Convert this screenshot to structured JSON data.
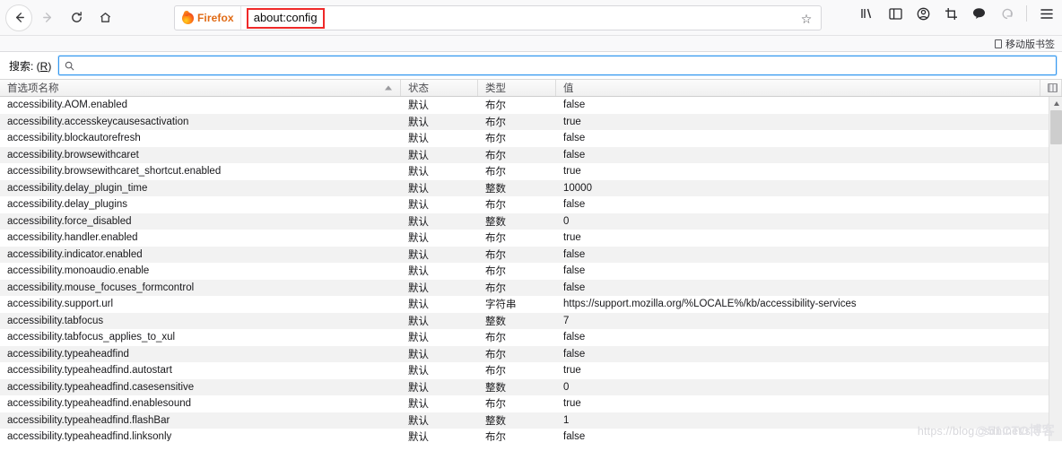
{
  "browser": {
    "nav": {
      "back_label": "Back",
      "forward_label": "Forward",
      "reload_label": "Reload",
      "home_label": "Home"
    },
    "urlbar": {
      "brand_label": "Firefox",
      "address": "about:config",
      "highlight_color": "#ef2929",
      "bookmark_star": "☆"
    },
    "toolbar_icons": [
      {
        "name": "library-icon",
        "glyph": "❙❙\\"
      },
      {
        "name": "sidebar-icon",
        "glyph": "▣"
      },
      {
        "name": "account-icon",
        "glyph": "◉"
      },
      {
        "name": "screenshot-icon",
        "glyph": "⛶"
      },
      {
        "name": "chat-icon",
        "glyph": "💬"
      },
      {
        "name": "sync-icon",
        "glyph": "↺"
      },
      {
        "name": "menu-icon",
        "glyph": "☰"
      }
    ],
    "bookmarks_bar": {
      "item_label": "移动版书签"
    }
  },
  "search": {
    "label_prefix": "搜索: (",
    "label_key": "R",
    "label_suffix": ")",
    "value": "",
    "placeholder": "",
    "icon": "search-icon"
  },
  "table": {
    "columns": [
      {
        "key": "name",
        "label": "首选项名称",
        "sorted": "asc"
      },
      {
        "key": "state",
        "label": "状态"
      },
      {
        "key": "type",
        "label": "类型"
      },
      {
        "key": "value",
        "label": "值"
      }
    ],
    "rows": [
      {
        "name": "accessibility.AOM.enabled",
        "state": "默认",
        "type": "布尔",
        "value": "false"
      },
      {
        "name": "accessibility.accesskeycausesactivation",
        "state": "默认",
        "type": "布尔",
        "value": "true"
      },
      {
        "name": "accessibility.blockautorefresh",
        "state": "默认",
        "type": "布尔",
        "value": "false"
      },
      {
        "name": "accessibility.browsewithcaret",
        "state": "默认",
        "type": "布尔",
        "value": "false"
      },
      {
        "name": "accessibility.browsewithcaret_shortcut.enabled",
        "state": "默认",
        "type": "布尔",
        "value": "true"
      },
      {
        "name": "accessibility.delay_plugin_time",
        "state": "默认",
        "type": "整数",
        "value": "10000"
      },
      {
        "name": "accessibility.delay_plugins",
        "state": "默认",
        "type": "布尔",
        "value": "false"
      },
      {
        "name": "accessibility.force_disabled",
        "state": "默认",
        "type": "整数",
        "value": "0"
      },
      {
        "name": "accessibility.handler.enabled",
        "state": "默认",
        "type": "布尔",
        "value": "true"
      },
      {
        "name": "accessibility.indicator.enabled",
        "state": "默认",
        "type": "布尔",
        "value": "false"
      },
      {
        "name": "accessibility.monoaudio.enable",
        "state": "默认",
        "type": "布尔",
        "value": "false"
      },
      {
        "name": "accessibility.mouse_focuses_formcontrol",
        "state": "默认",
        "type": "布尔",
        "value": "false"
      },
      {
        "name": "accessibility.support.url",
        "state": "默认",
        "type": "字符串",
        "value": "https://support.mozilla.org/%LOCALE%/kb/accessibility-services"
      },
      {
        "name": "accessibility.tabfocus",
        "state": "默认",
        "type": "整数",
        "value": "7"
      },
      {
        "name": "accessibility.tabfocus_applies_to_xul",
        "state": "默认",
        "type": "布尔",
        "value": "false"
      },
      {
        "name": "accessibility.typeaheadfind",
        "state": "默认",
        "type": "布尔",
        "value": "false"
      },
      {
        "name": "accessibility.typeaheadfind.autostart",
        "state": "默认",
        "type": "布尔",
        "value": "true"
      },
      {
        "name": "accessibility.typeaheadfind.casesensitive",
        "state": "默认",
        "type": "整数",
        "value": "0"
      },
      {
        "name": "accessibility.typeaheadfind.enablesound",
        "state": "默认",
        "type": "布尔",
        "value": "true"
      },
      {
        "name": "accessibility.typeaheadfind.flashBar",
        "state": "默认",
        "type": "整数",
        "value": "1"
      },
      {
        "name": "accessibility.typeaheadfind.linksonly",
        "state": "默认",
        "type": "布尔",
        "value": "false"
      }
    ]
  },
  "watermark": {
    "url": "https://blog.csdn.net/s",
    "brand": "@51CTO博客"
  }
}
